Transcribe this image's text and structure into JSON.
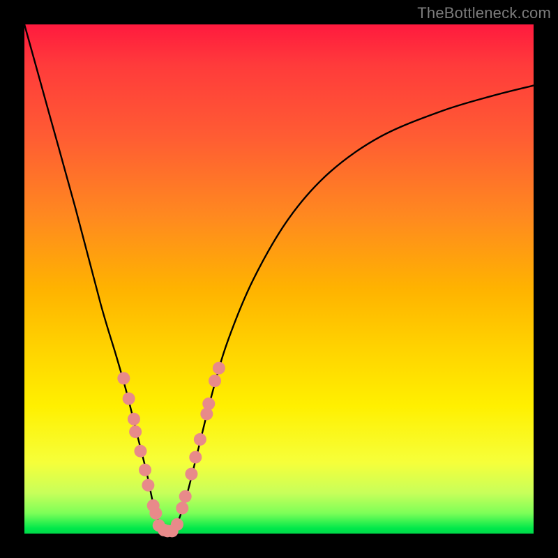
{
  "watermark": "TheBottleneck.com",
  "chart_data": {
    "type": "line",
    "title": "",
    "xlabel": "",
    "ylabel": "",
    "xlim": [
      0,
      1
    ],
    "ylim": [
      0,
      1
    ],
    "annotations": [],
    "background_gradient_stops": [
      {
        "pos": 0.0,
        "color": "#ff1a3e"
      },
      {
        "pos": 0.5,
        "color": "#ffb300"
      },
      {
        "pos": 0.8,
        "color": "#fff000"
      },
      {
        "pos": 0.96,
        "color": "#7dff58"
      },
      {
        "pos": 1.0,
        "color": "#00d94a"
      }
    ],
    "series": [
      {
        "name": "bottleneck-curve",
        "color": "#000000",
        "x": [
          0.0,
          0.05,
          0.1,
          0.15,
          0.18,
          0.2,
          0.22,
          0.24,
          0.255,
          0.27,
          0.283,
          0.3,
          0.32,
          0.34,
          0.37,
          0.4,
          0.45,
          0.52,
          0.6,
          0.7,
          0.82,
          0.92,
          1.0
        ],
        "y": [
          1.0,
          0.82,
          0.64,
          0.45,
          0.35,
          0.28,
          0.2,
          0.12,
          0.05,
          0.01,
          0.005,
          0.02,
          0.08,
          0.16,
          0.28,
          0.38,
          0.5,
          0.62,
          0.71,
          0.78,
          0.83,
          0.86,
          0.88
        ]
      }
    ],
    "scatter": {
      "name": "sample-markers",
      "color": "#e88a8a",
      "radius": 9,
      "points": [
        {
          "x": 0.195,
          "y": 0.305
        },
        {
          "x": 0.205,
          "y": 0.265
        },
        {
          "x": 0.215,
          "y": 0.225
        },
        {
          "x": 0.218,
          "y": 0.2
        },
        {
          "x": 0.228,
          "y": 0.162
        },
        {
          "x": 0.237,
          "y": 0.125
        },
        {
          "x": 0.243,
          "y": 0.095
        },
        {
          "x": 0.253,
          "y": 0.055
        },
        {
          "x": 0.258,
          "y": 0.04
        },
        {
          "x": 0.264,
          "y": 0.016
        },
        {
          "x": 0.274,
          "y": 0.007
        },
        {
          "x": 0.281,
          "y": 0.005
        },
        {
          "x": 0.29,
          "y": 0.005
        },
        {
          "x": 0.3,
          "y": 0.018
        },
        {
          "x": 0.31,
          "y": 0.05
        },
        {
          "x": 0.316,
          "y": 0.073
        },
        {
          "x": 0.328,
          "y": 0.117
        },
        {
          "x": 0.336,
          "y": 0.15
        },
        {
          "x": 0.345,
          "y": 0.185
        },
        {
          "x": 0.358,
          "y": 0.235
        },
        {
          "x": 0.362,
          "y": 0.255
        },
        {
          "x": 0.374,
          "y": 0.3
        },
        {
          "x": 0.382,
          "y": 0.325
        }
      ]
    }
  }
}
